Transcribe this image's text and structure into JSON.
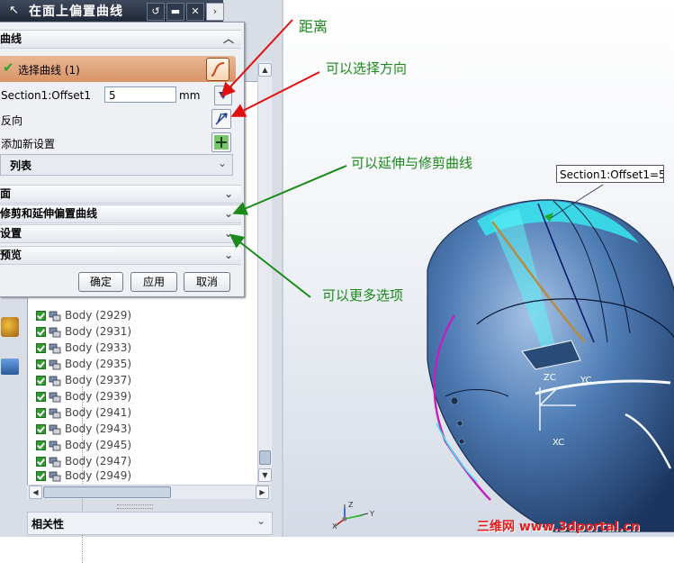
{
  "dialog": {
    "title": "在面上偏置曲线",
    "curve_section": "曲线",
    "select_curve": "选择曲线 (1)",
    "offset_label": "Section1:Offset1",
    "offset_value": "5",
    "unit": "mm",
    "reverse_label": "反向",
    "add_setting_label": "添加新设置",
    "list_label": "列表",
    "face_section": "面",
    "trim_section": "修剪和延伸偏置曲线",
    "settings_section": "设置",
    "preview_section": "预览",
    "ok_label": "确定",
    "apply_label": "应用",
    "cancel_label": "取消"
  },
  "navigator": {
    "rows": [
      {
        "label": "Body (2929)"
      },
      {
        "label": "Body (2931)"
      },
      {
        "label": "Body (2933)"
      },
      {
        "label": "Body (2935)"
      },
      {
        "label": "Body (2937)"
      },
      {
        "label": "Body (2939)"
      },
      {
        "label": "Body (2941)"
      },
      {
        "label": "Body (2943)"
      },
      {
        "label": "Body (2945)"
      },
      {
        "label": "Body (2947)"
      },
      {
        "label": "Body (2949)"
      }
    ],
    "related_panel": "相关性"
  },
  "viewport": {
    "dimension_label": "Section1:Offset1=5",
    "axis_zc": "ZC",
    "axis_yc": "YC",
    "axis_xc": "XC",
    "triad_z": "Z",
    "triad_y": "Y",
    "triad_x": "X"
  },
  "annotations": {
    "distance": "距离",
    "choose_direction": "可以选择方向",
    "extend_trim": "可以延伸与修剪曲线",
    "more_options": "可以更多选项"
  },
  "watermark": "三维网 www.3dportal.cn",
  "colors": {
    "title_bar": "#1f2838",
    "selected_row": "#d99466",
    "arrow_red": "#e01010",
    "arrow_green": "#1a8a1a",
    "helmet_blue": "#3e6aa0",
    "highlight_cyan": "#38e8f0",
    "offset_curve": "#b98a3a",
    "edge_magenta": "#c020c0"
  }
}
